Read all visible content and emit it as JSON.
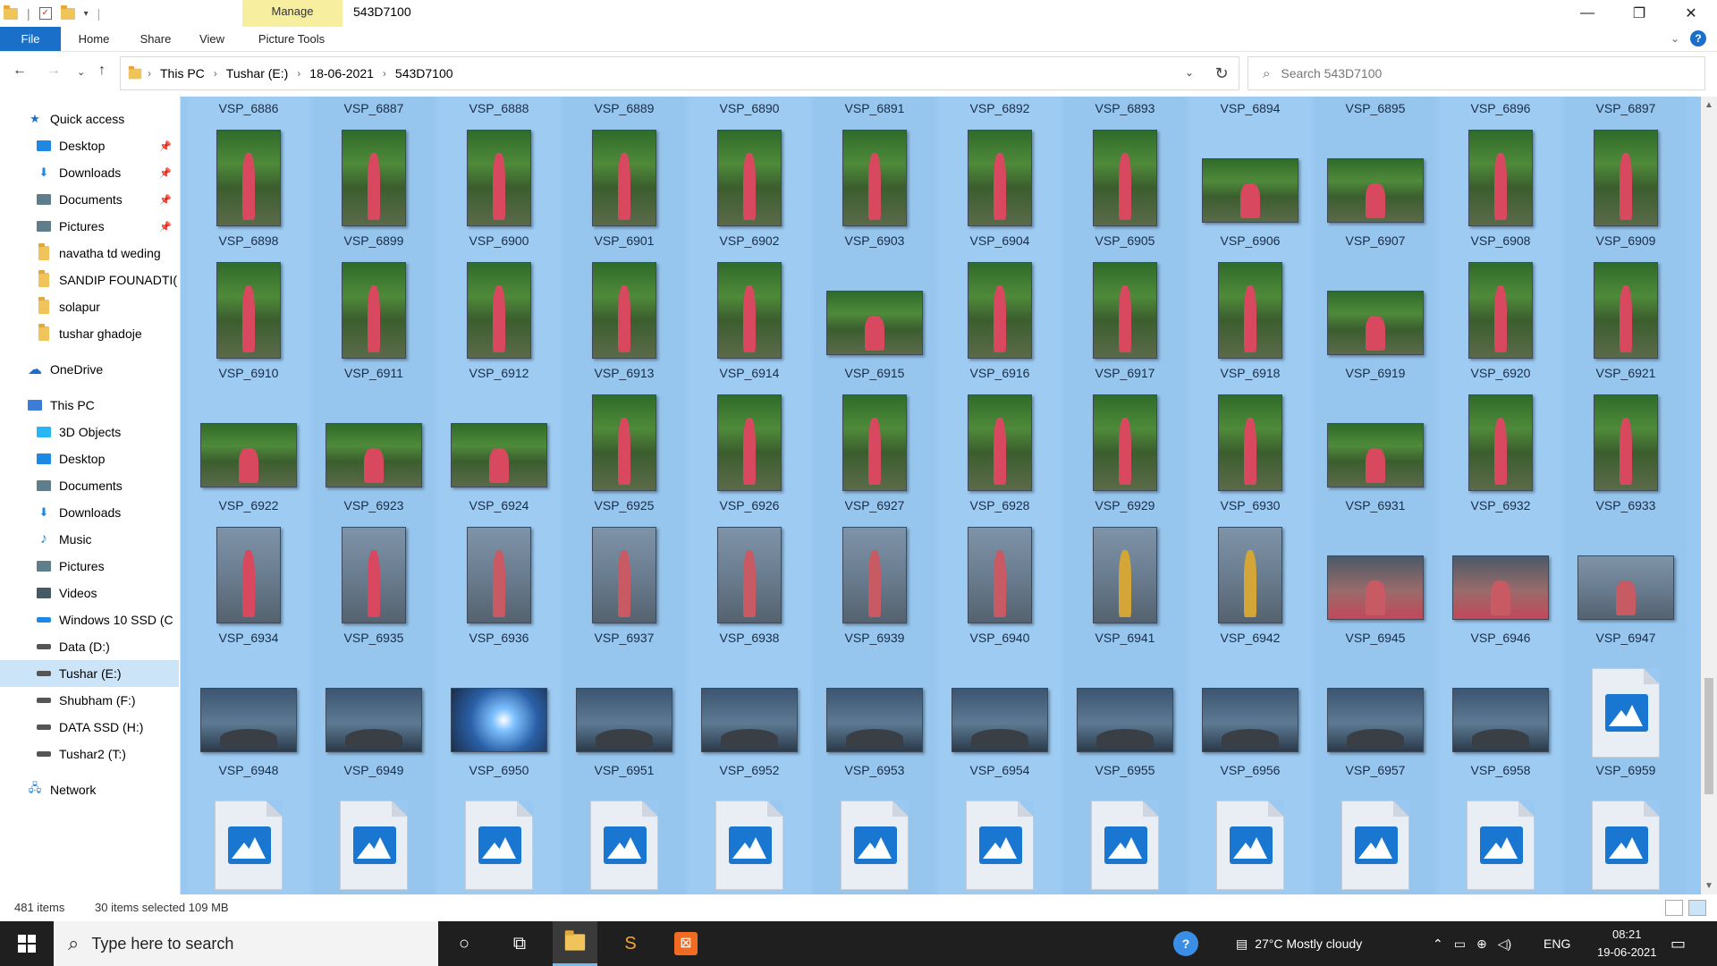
{
  "window": {
    "title": "543D7100",
    "manage_tab": "Manage",
    "minimize": "—",
    "maximize": "❐",
    "close": "✕"
  },
  "ribbon": {
    "tabs": [
      "File",
      "Home",
      "Share",
      "View",
      "Picture Tools"
    ]
  },
  "address": {
    "crumbs": [
      "This PC",
      "Tushar (E:)",
      "18-06-2021",
      "543D7100"
    ],
    "search_placeholder": "Search 543D7100"
  },
  "sidebar": {
    "items": [
      {
        "label": "Quick access",
        "icon": "star-icon",
        "color": "#1a6fc9"
      },
      {
        "label": "Desktop",
        "icon": "desktop-icon",
        "pinned": true,
        "color": "#1e88e5"
      },
      {
        "label": "Downloads",
        "icon": "download-icon",
        "pinned": true,
        "color": "#1e88e5"
      },
      {
        "label": "Documents",
        "icon": "documents-icon",
        "pinned": true,
        "color": "#607d8b"
      },
      {
        "label": "Pictures",
        "icon": "pictures-icon",
        "pinned": true,
        "color": "#607d8b"
      },
      {
        "label": "navatha td weding",
        "icon": "folder-icon",
        "color": "#f0c45a"
      },
      {
        "label": "SANDIP FOUNADTI(",
        "icon": "folder-icon",
        "color": "#f0c45a"
      },
      {
        "label": "solapur",
        "icon": "folder-icon",
        "color": "#f0c45a"
      },
      {
        "label": "tushar ghadoje",
        "icon": "folder-icon",
        "color": "#f0c45a"
      },
      {
        "label": "OneDrive",
        "icon": "cloud-icon",
        "color": "#1a6fc9"
      },
      {
        "label": "This PC",
        "icon": "pc-icon",
        "color": "#3b7dd8"
      },
      {
        "label": "3D Objects",
        "icon": "cube-icon",
        "color": "#29b6f6"
      },
      {
        "label": "Desktop",
        "icon": "desktop-icon",
        "color": "#1e88e5"
      },
      {
        "label": "Documents",
        "icon": "documents-icon",
        "color": "#607d8b"
      },
      {
        "label": "Downloads",
        "icon": "download-icon",
        "color": "#1e88e5"
      },
      {
        "label": "Music",
        "icon": "music-icon",
        "color": "#1e88e5"
      },
      {
        "label": "Pictures",
        "icon": "pictures-icon",
        "color": "#607d8b"
      },
      {
        "label": "Videos",
        "icon": "film-icon",
        "color": "#455a64"
      },
      {
        "label": "Windows 10 SSD (C",
        "icon": "drive-icon",
        "color": "#1e88e5"
      },
      {
        "label": "Data (D:)",
        "icon": "drive-icon",
        "color": "#555555"
      },
      {
        "label": "Tushar (E:)",
        "icon": "drive-icon",
        "color": "#555555",
        "selected": true
      },
      {
        "label": "Shubham (F:)",
        "icon": "drive-icon",
        "color": "#555555"
      },
      {
        "label": "DATA SSD (H:)",
        "icon": "drive-icon",
        "color": "#555555"
      },
      {
        "label": "Tushar2 (T:)",
        "icon": "drive-icon",
        "color": "#555555"
      },
      {
        "label": "Network",
        "icon": "network-icon",
        "color": "#1e88e5"
      }
    ]
  },
  "files": {
    "rows": [
      [
        "VSP_6886",
        "VSP_6887",
        "VSP_6888",
        "VSP_6889",
        "VSP_6890",
        "VSP_6891",
        "VSP_6892",
        "VSP_6893",
        "VSP_6894",
        "VSP_6895",
        "VSP_6896",
        "VSP_6897"
      ],
      [
        "VSP_6898",
        "VSP_6899",
        "VSP_6900",
        "VSP_6901",
        "VSP_6902",
        "VSP_6903",
        "VSP_6904",
        "VSP_6905",
        "VSP_6906",
        "VSP_6907",
        "VSP_6908",
        "VSP_6909"
      ],
      [
        "VSP_6910",
        "VSP_6911",
        "VSP_6912",
        "VSP_6913",
        "VSP_6914",
        "VSP_6915",
        "VSP_6916",
        "VSP_6917",
        "VSP_6918",
        "VSP_6919",
        "VSP_6920",
        "VSP_6921"
      ],
      [
        "VSP_6922",
        "VSP_6923",
        "VSP_6924",
        "VSP_6925",
        "VSP_6926",
        "VSP_6927",
        "VSP_6928",
        "VSP_6929",
        "VSP_6930",
        "VSP_6931",
        "VSP_6932",
        "VSP_6933"
      ],
      [
        "VSP_6934",
        "VSP_6935",
        "VSP_6936",
        "VSP_6937",
        "VSP_6938",
        "VSP_6939",
        "VSP_6940",
        "VSP_6941",
        "VSP_6942",
        "VSP_6945",
        "VSP_6946",
        "VSP_6947"
      ],
      [
        "VSP_6948",
        "VSP_6949",
        "VSP_6950",
        "VSP_6951",
        "VSP_6952",
        "VSP_6953",
        "VSP_6954",
        "VSP_6955",
        "VSP_6956",
        "VSP_6957",
        "VSP_6958",
        "VSP_6959"
      ],
      [
        "",
        "",
        "",
        "",
        "",
        "",
        "",
        "",
        "",
        "",
        "",
        ""
      ]
    ]
  },
  "status": {
    "item_count": "481 items",
    "selected": "30 items selected  109 MB"
  },
  "taskbar": {
    "search_placeholder": "Type here to search",
    "weather": "27°C  Mostly cloudy",
    "lang": "ENG",
    "time": "08:21",
    "date": "19-06-2021"
  }
}
